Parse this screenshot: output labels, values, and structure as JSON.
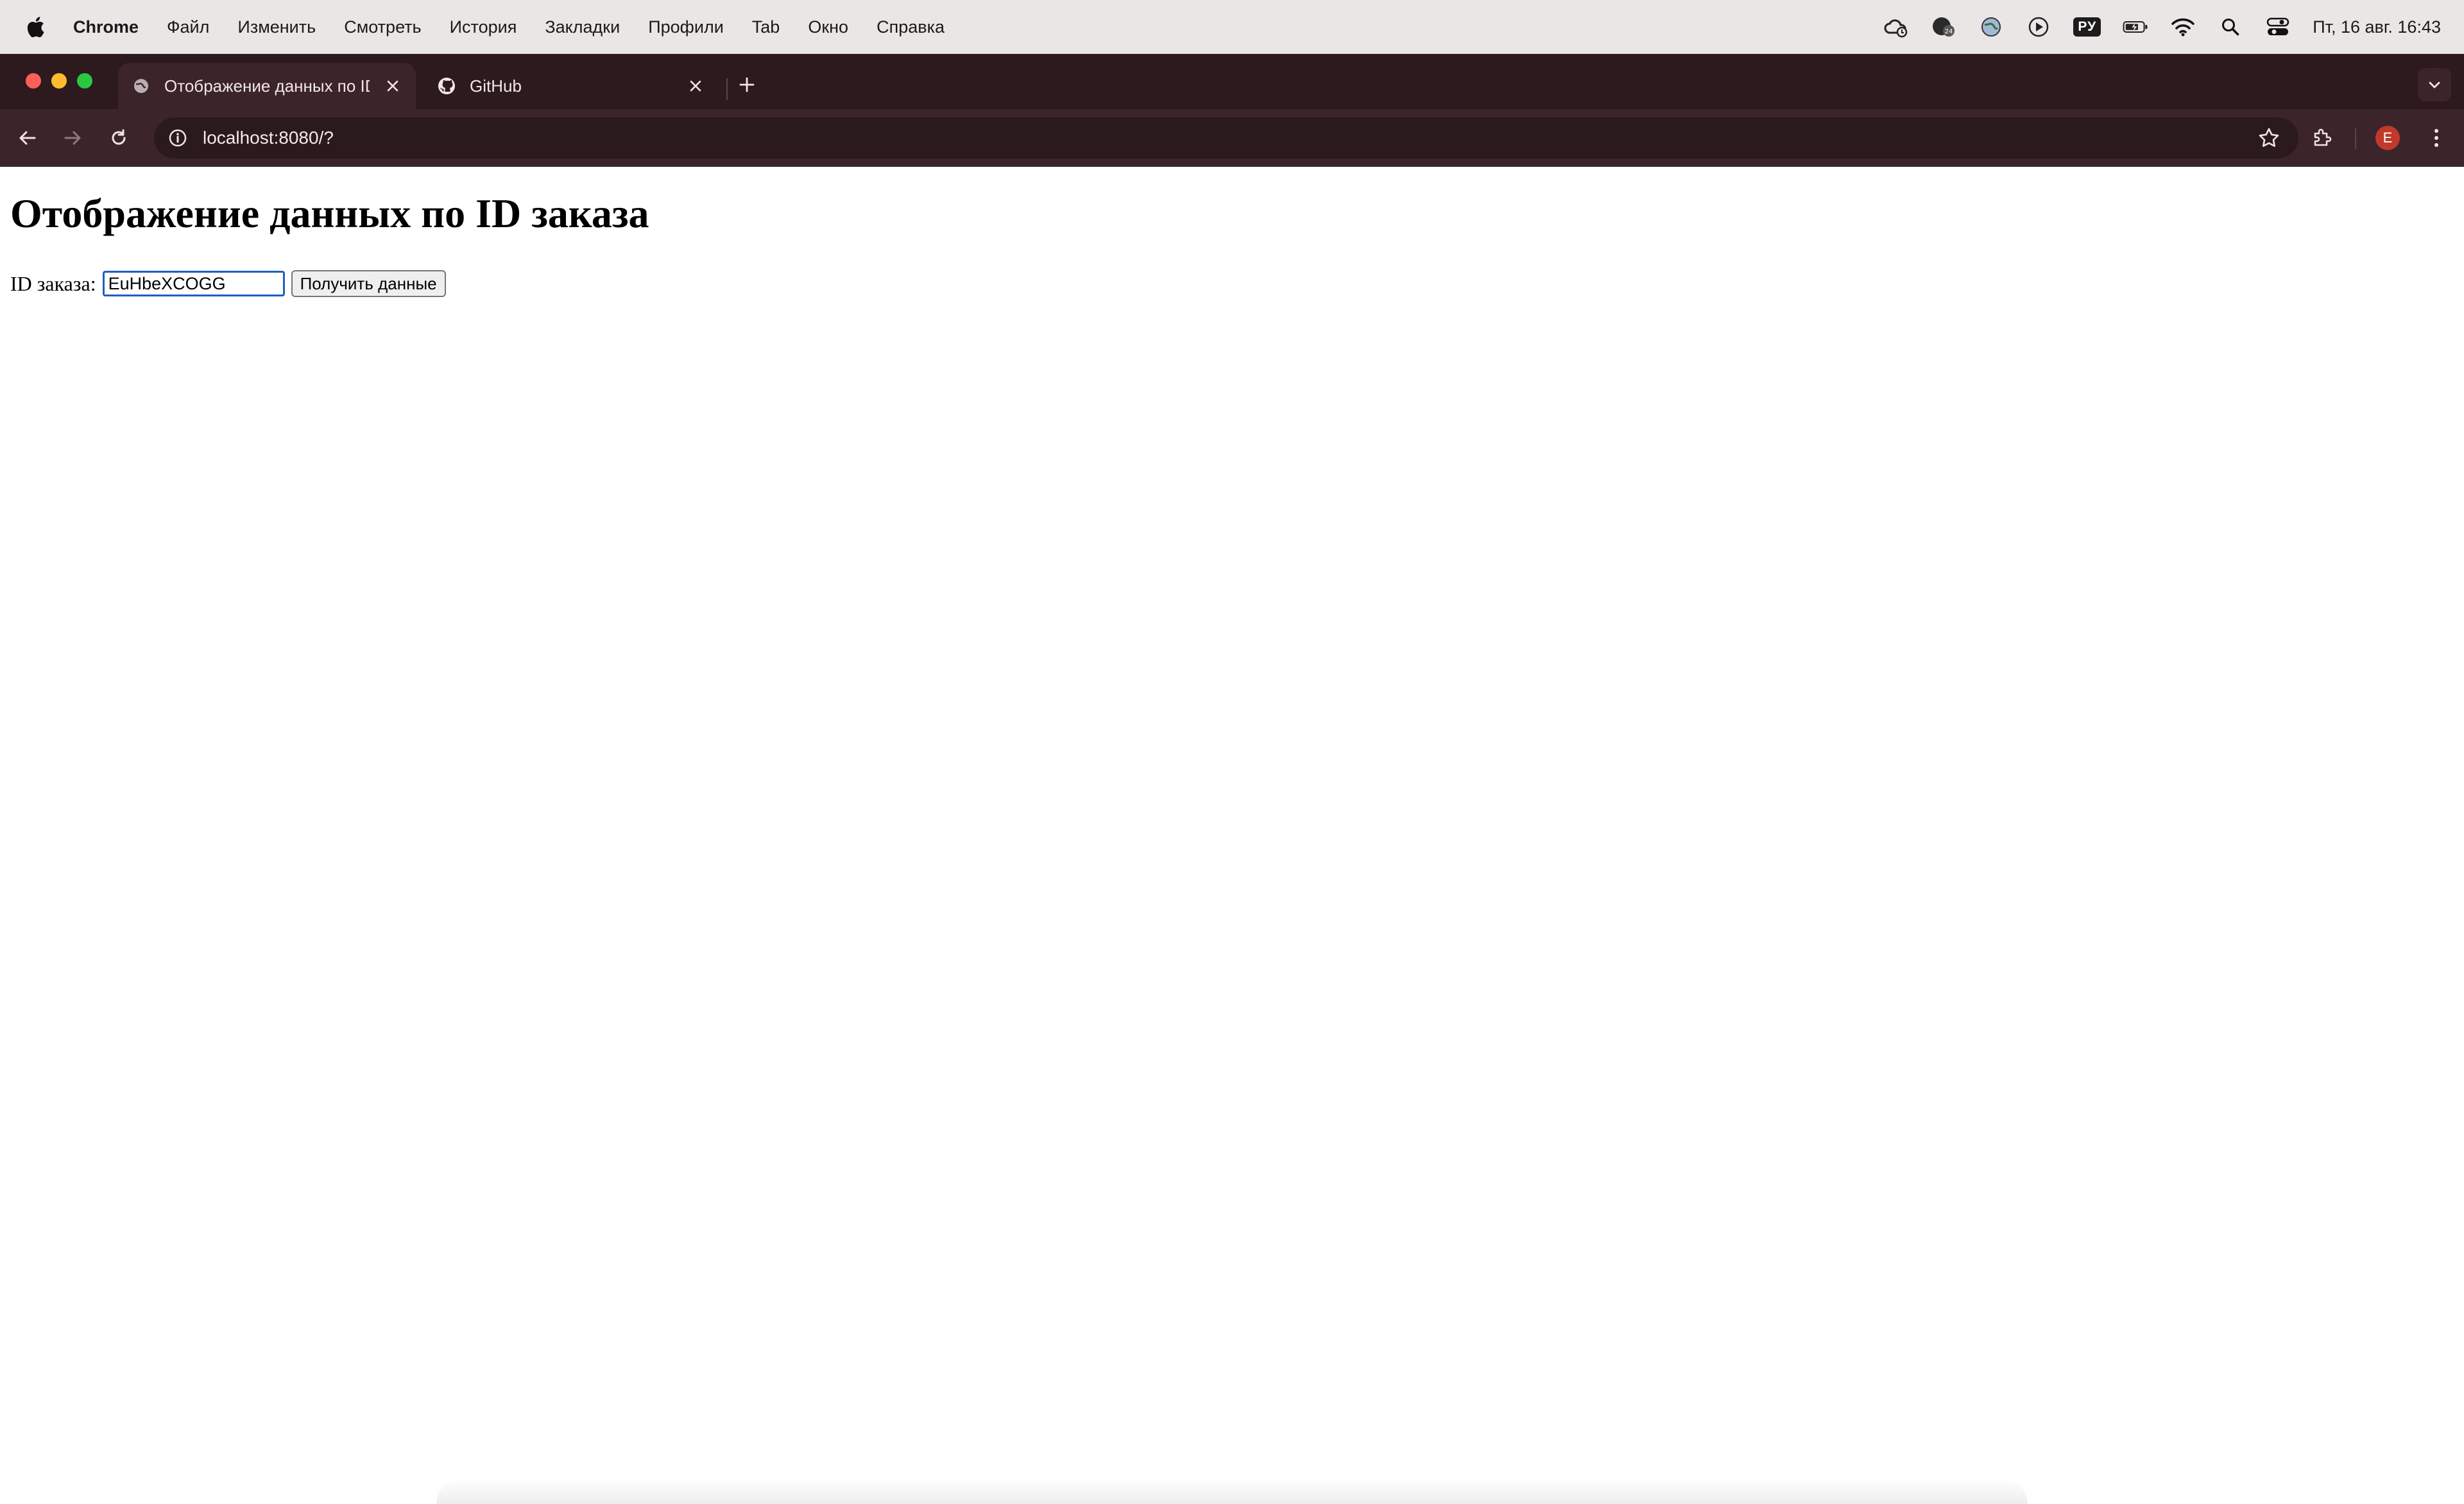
{
  "menubar": {
    "app_name": "Chrome",
    "items": [
      "Файл",
      "Изменить",
      "Смотреть",
      "История",
      "Закладки",
      "Профили",
      "Tab",
      "Окно",
      "Справка"
    ],
    "status": {
      "language": "РУ",
      "clock": "Пт, 16 авг.  16:43",
      "icons": [
        "cloud-sync-icon",
        "vpn-badge-icon",
        "globe-icon",
        "play-icon",
        "language-icon",
        "battery-icon",
        "wifi-icon",
        "spotlight-search-icon",
        "control-center-icon"
      ]
    }
  },
  "browser": {
    "tabs": [
      {
        "title": "Отображение данных по ID заказа",
        "active": true,
        "icon": "globe-icon"
      },
      {
        "title": "GitHub",
        "active": false,
        "icon": "github-icon"
      }
    ],
    "url": "localhost:8080/?",
    "profile_initial": "E"
  },
  "page": {
    "title": "Отображение данных по ID заказа",
    "form": {
      "label": "ID заказа:",
      "value": "EuHbeXCOGG",
      "button": "Получить данные"
    }
  }
}
